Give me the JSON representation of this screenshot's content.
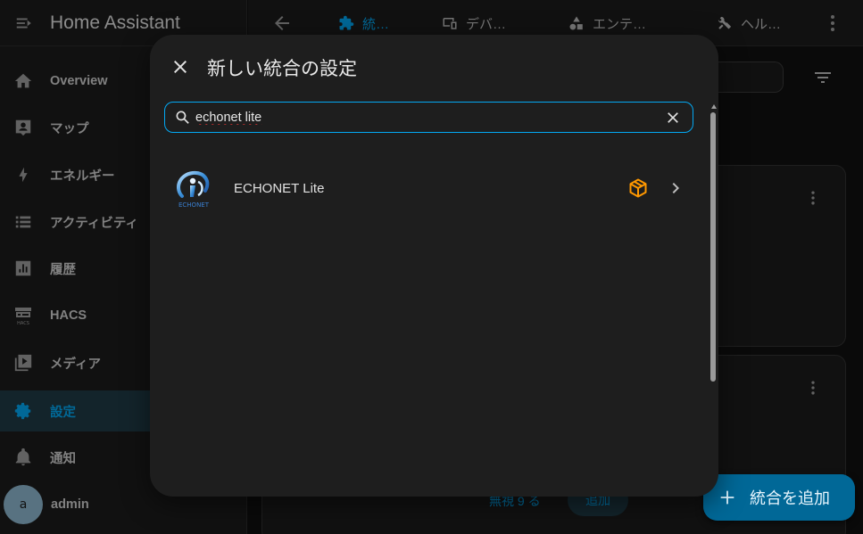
{
  "app": {
    "title": "Home Assistant"
  },
  "sidebar": {
    "items": [
      {
        "label": "Overview",
        "icon": "home-icon"
      },
      {
        "label": "マップ",
        "icon": "map-icon"
      },
      {
        "label": "エネルギー",
        "icon": "lightning-icon"
      },
      {
        "label": "アクティビティ",
        "icon": "list-icon"
      },
      {
        "label": "履歴",
        "icon": "chart-icon"
      },
      {
        "label": "HACS",
        "icon": "hacs-icon"
      },
      {
        "label": "メディア",
        "icon": "media-icon"
      },
      {
        "label": "設定",
        "icon": "gear-icon",
        "active": true
      },
      {
        "label": "通知",
        "icon": "bell-icon"
      }
    ],
    "user": {
      "avatar_letter": "a",
      "name": "admin"
    }
  },
  "topbar": {
    "tabs": [
      {
        "label": "統…",
        "icon": "puzzle-icon",
        "active": true
      },
      {
        "label": "デバ…",
        "icon": "devices-icon"
      },
      {
        "label": "エンテ…",
        "icon": "shapes-icon"
      },
      {
        "label": "ヘル…",
        "icon": "tools-icon"
      }
    ]
  },
  "background": {
    "card_link": "無視 9 る",
    "card_button": "追加"
  },
  "fab": {
    "label": "統合を追加"
  },
  "dialog": {
    "title": "新しい統合の設定",
    "search": {
      "value": "echonet lite",
      "placeholder": ""
    },
    "results": [
      {
        "name": "ECHONET Lite",
        "logo_text": "ECHONET",
        "custom": true
      }
    ]
  },
  "colors": {
    "accent": "#03a9f4",
    "custom_badge": "#ff9800",
    "background": "#111111",
    "dialog": "#1e1e1e"
  }
}
